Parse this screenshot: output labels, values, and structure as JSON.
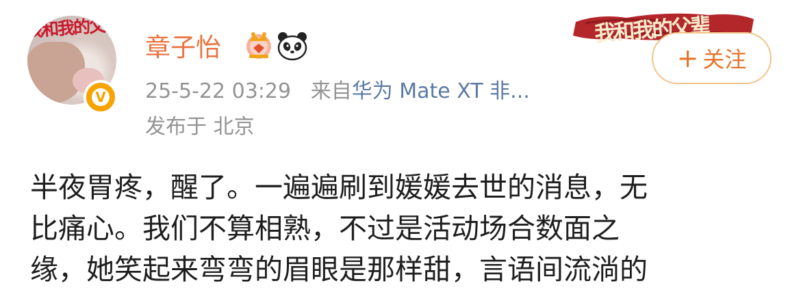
{
  "avatar": {
    "poster_text": "我和我的父辈"
  },
  "user": {
    "name": "章子怡"
  },
  "post": {
    "timestamp": "25-5-22 03:29",
    "source_prefix": "来自",
    "device": "华为 Mate XT 非...",
    "location": "发布于 北京",
    "lines": [
      "半夜胃疼，醒了。一遍遍刷到媛媛去世的消息，无",
      "比痛心。我们不算相熟，不过是活动场合数面之",
      "缘，她笑起来弯弯的眉眼是那样甜，言语间流淌的"
    ]
  },
  "banner": {
    "text": "我和我的父辈"
  },
  "follow_button": {
    "plus": "+",
    "label": "关注"
  },
  "colors": {
    "username": "#eb7340",
    "meta": "#939393",
    "device_link": "#5b7aa3",
    "follow_border": "#f2c28a",
    "follow_text": "#e5742d",
    "banner_bg": "#b3262a",
    "verified_badge": "#f7a400"
  },
  "icons": {
    "badge_1": "crown-icon",
    "badge_2": "panda-icon",
    "verified": "verified-v-icon"
  }
}
